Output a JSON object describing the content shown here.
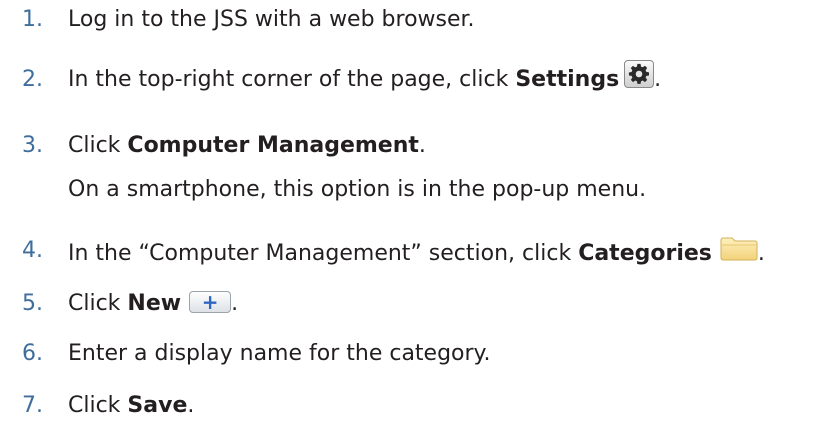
{
  "steps": [
    {
      "number": "1.",
      "text": "Log in to the JSS with a web browser."
    },
    {
      "number": "2.",
      "text_before": "In the top-right corner of the page, click ",
      "bold": "Settings",
      "icon": "gear-icon",
      "text_after": "."
    },
    {
      "number": "3.",
      "text_before": "Click ",
      "bold": "Computer Management",
      "text_after": ".",
      "note": "On a smartphone, this option is in the pop-up menu."
    },
    {
      "number": "4.",
      "text_before": "In the “Computer Management” section, click ",
      "bold": "Categories",
      "icon": "folder-icon",
      "text_after": "."
    },
    {
      "number": "5.",
      "text_before": "Click ",
      "bold": "New",
      "icon": "plus-icon",
      "icon_glyph": "+",
      "text_after": "."
    },
    {
      "number": "6.",
      "text": "Enter a display name for the category."
    },
    {
      "number": "7.",
      "text_before": "Click ",
      "bold": "Save",
      "text_after": "."
    }
  ],
  "colors": {
    "number": "#3f6e9c",
    "text": "#231f20",
    "plus": "#2f66c4",
    "folder": "#f2d27a"
  }
}
